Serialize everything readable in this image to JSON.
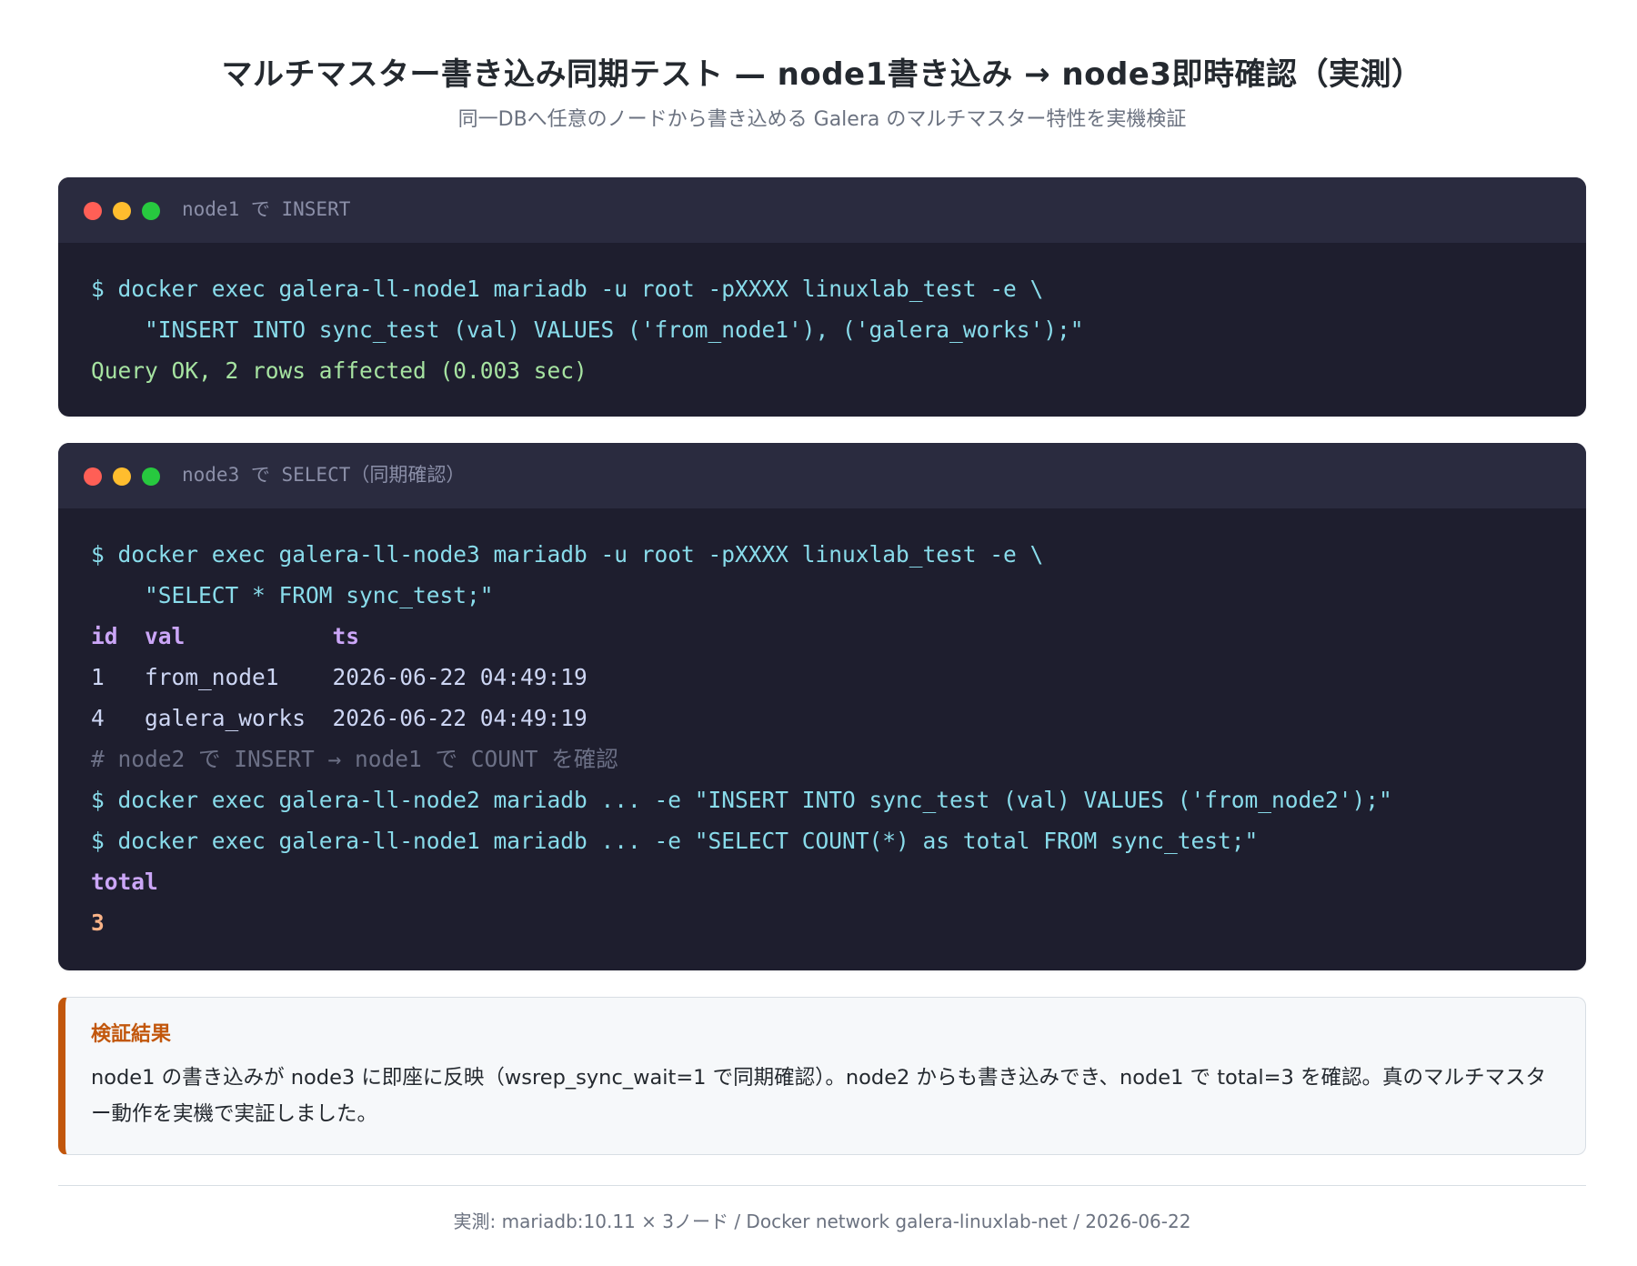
{
  "header": {
    "title": "マルチマスター書き込み同期テスト — node1書き込み → node3即時確認（実測）",
    "subtitle": "同一DBへ任意のノードから書き込める Galera のマルチマスター特性を実機検証"
  },
  "terminal1": {
    "title": "node1 で INSERT",
    "lines": [
      "$ docker exec galera-ll-node1 mariadb -u root -pXXXX linuxlab_test -e \\",
      "    \"INSERT INTO sync_test (val) VALUES ('from_node1'), ('galera_works');\"",
      "Query OK, 2 rows affected (0.003 sec)"
    ]
  },
  "terminal2": {
    "title": "node3 で SELECT（同期確認）",
    "lines": [
      "$ docker exec galera-ll-node3 mariadb -u root -pXXXX linuxlab_test -e \\",
      "    \"SELECT * FROM sync_test;\"",
      "id  val           ts",
      "1   from_node1    2026-06-22 04:49:19",
      "4   galera_works  2026-06-22 04:49:19",
      "# node2 で INSERT → node1 で COUNT を確認",
      "$ docker exec galera-ll-node2 mariadb ... -e \"INSERT INTO sync_test (val) VALUES ('from_node2');\"",
      "$ docker exec galera-ll-node1 mariadb ... -e \"SELECT COUNT(*) as total FROM sync_test;\"",
      "total",
      "3"
    ]
  },
  "result": {
    "title": "検証結果",
    "text": "node1 の書き込みが node3 に即座に反映（wsrep_sync_wait=1 で同期確認）。node2 からも書き込みでき、node1 で total=3 を確認。真のマルチマスター動作を実機で実証しました。"
  },
  "footer": {
    "text": "実測: mariadb:10.11 × 3ノード / Docker network galera-linuxlab-net / 2026-06-22"
  },
  "colors": {
    "terminal_bg": "#1e1e2e",
    "terminal_bar": "#2a2b3f",
    "command": "#89dceb",
    "ok": "#a6e3a1",
    "header": "#cba6f7",
    "accent": "#c2570c"
  }
}
